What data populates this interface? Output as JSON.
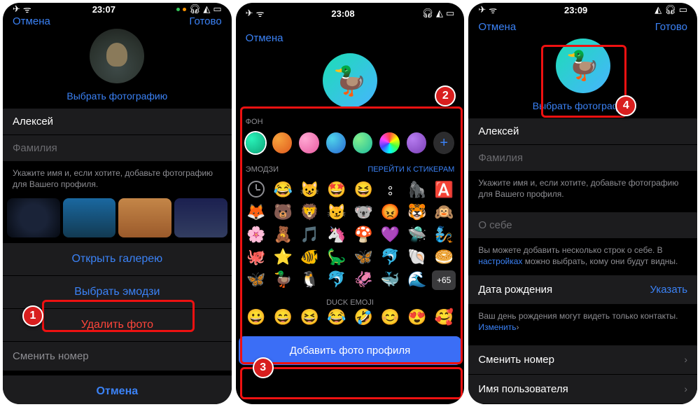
{
  "status": {
    "time1": "23:07",
    "time2": "23:08",
    "time3": "23:09"
  },
  "nav": {
    "cancel": "Отмена",
    "done": "Готово"
  },
  "profile": {
    "choose_photo": "Выбрать фотографию",
    "first_name": "Алексей",
    "last_name_ph": "Фамилия",
    "hint": "Укажите имя и, если хотите, добавьте фотографию для Вашего профиля."
  },
  "sheet": {
    "open_gallery": "Открыть галерею",
    "choose_emoji": "Выбрать эмодзи",
    "delete_photo": "Удалить фото",
    "change_number": "Сменить номер",
    "cancel": "Отмена"
  },
  "emoji_picker": {
    "bg_label": "ФОН",
    "emoji_label": "ЭМОДЗИ",
    "go_stickers": "ПЕРЕЙТИ К СТИКЕРАМ",
    "more": "+65",
    "duck_cat": "DUCK EMOJI",
    "add_btn": "Добавить фото профиля",
    "row1": [
      "🕒",
      "😂",
      "😺",
      "🤩",
      "😆",
      "⦂",
      "🦍",
      "🅰️"
    ],
    "row2": [
      "🦊",
      "🐻",
      "🦁",
      "😼",
      "🐨",
      "😡",
      "🐯",
      "🙉"
    ],
    "row3": [
      "🌸",
      "🧸",
      "🎵",
      "🦄",
      "🍄",
      "💜",
      "🛸",
      "🧞"
    ],
    "row4": [
      "🐙",
      "⭐",
      "🐠",
      "🦕",
      "🦋",
      "🐬",
      "🐚",
      "🥯"
    ],
    "row5": [
      "🦋",
      "🦆",
      "🐧",
      "🐬",
      "🦑",
      "🐳",
      "🌊",
      ""
    ],
    "duck_row": [
      "😀",
      "😄",
      "😆",
      "😂",
      "🤣",
      "😊",
      "😍",
      "🥰"
    ]
  },
  "about": {
    "placeholder": "О себе",
    "hint_pre": "Вы можете добавить несколько строк о себе. В ",
    "hint_link": "настройках",
    "hint_post": " можно выбрать, кому они будут видны."
  },
  "dob": {
    "label": "Дата рождения",
    "set": "Указать",
    "hint_pre": "Ваш день рождения могут видеть только контакты. ",
    "hint_link": "Изменить",
    "arrow": "›"
  },
  "links": {
    "change_number": "Сменить номер",
    "username": "Имя пользователя"
  },
  "badges": {
    "b1": "1",
    "b2": "2",
    "b3": "3",
    "b4": "4"
  }
}
